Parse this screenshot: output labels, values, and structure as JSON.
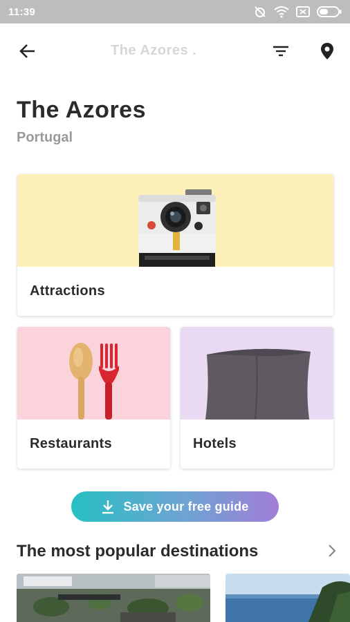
{
  "status_bar": {
    "time": "11:39",
    "icons": [
      "alarm-off-icon",
      "wifi-icon",
      "sim-icon",
      "battery-icon"
    ]
  },
  "app_bar": {
    "title": "The Azores ."
  },
  "header": {
    "title": "The Azores",
    "subtitle": "Portugal"
  },
  "categories": [
    {
      "label": "Attractions",
      "bg": "#fdf0ba"
    },
    {
      "label": "Restaurants",
      "bg": "#fbd3da"
    },
    {
      "label": "Hotels",
      "bg": "#ead9f3"
    }
  ],
  "save_button": {
    "label": "Save your free guide"
  },
  "popular": {
    "title": "The most popular destinations"
  },
  "colors": {
    "accent_start": "#26c0c3",
    "accent_end": "#a07ed6",
    "status_bar": "#bdbdbd"
  }
}
